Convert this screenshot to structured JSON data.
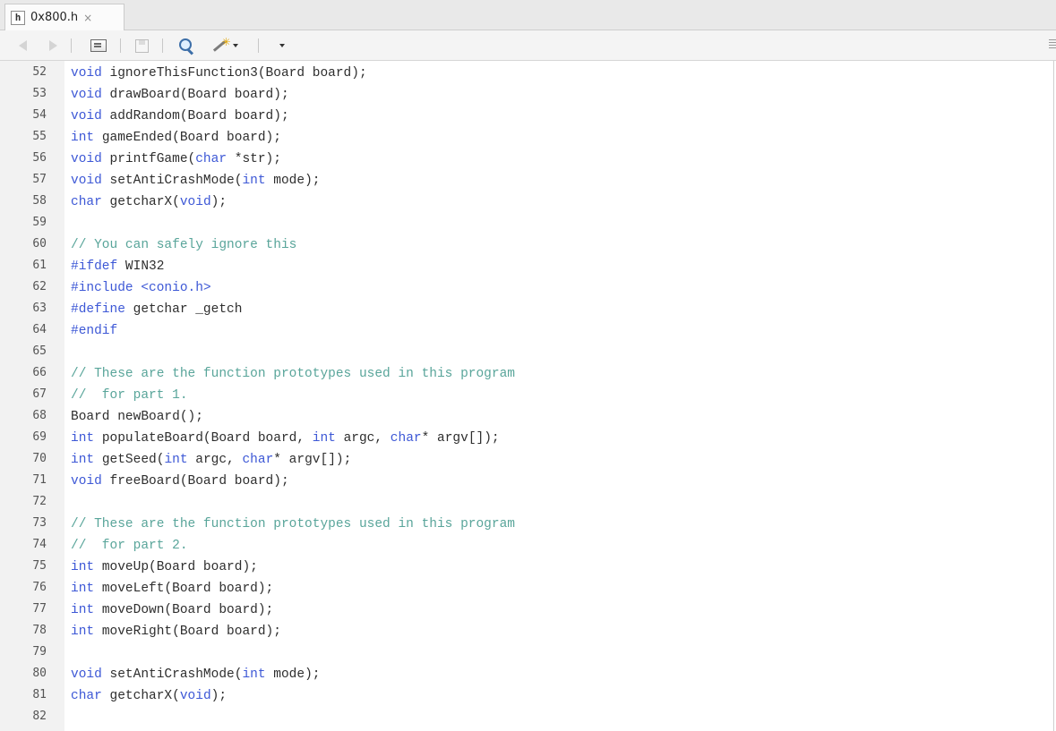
{
  "tab": {
    "icon_letter": "h",
    "title": "0x800.h",
    "close": "×"
  },
  "toolbar": {
    "icons": [
      "back-icon",
      "forward-icon",
      "source-icon",
      "save-icon",
      "search-icon",
      "wand-icon",
      "dropdown-icon",
      "menu-icon"
    ]
  },
  "colors": {
    "keyword": "#3d58d6",
    "comment": "#59a59a",
    "text": "#2e2e2e",
    "gutter": "#f2f2f2"
  },
  "code_lines": [
    {
      "n": "52",
      "t": [
        [
          "kw",
          "void"
        ],
        [
          "",
          "ignoreThisFunction3(Board board);"
        ]
      ]
    },
    {
      "n": "53",
      "t": [
        [
          "kw",
          "void"
        ],
        [
          "",
          "drawBoard(Board board);"
        ]
      ]
    },
    {
      "n": "54",
      "t": [
        [
          "kw",
          "void"
        ],
        [
          "",
          "addRandom(Board board);"
        ]
      ]
    },
    {
      "n": "55",
      "t": [
        [
          "kw",
          "int"
        ],
        [
          "",
          "gameEnded(Board board);"
        ]
      ]
    },
    {
      "n": "56",
      "t": [
        [
          "kw",
          "void"
        ],
        [
          "",
          "printfGame("
        ],
        [
          "kw",
          "char"
        ],
        [
          "",
          " *str);"
        ]
      ]
    },
    {
      "n": "57",
      "t": [
        [
          "kw",
          "void"
        ],
        [
          "",
          "setAntiCrashMode("
        ],
        [
          "kw",
          "int"
        ],
        [
          "",
          " mode);"
        ]
      ]
    },
    {
      "n": "58",
      "t": [
        [
          "kw",
          "char"
        ],
        [
          "",
          "getcharX("
        ],
        [
          "kw",
          "void"
        ],
        [
          "",
          ");"
        ]
      ]
    },
    {
      "n": "59",
      "t": []
    },
    {
      "n": "60",
      "t": [
        [
          "cm",
          "// You can safely ignore this"
        ]
      ]
    },
    {
      "n": "61",
      "t": [
        [
          "pp",
          "#ifdef"
        ],
        [
          "",
          " WIN32"
        ]
      ]
    },
    {
      "n": "62",
      "t": [
        [
          "pp",
          "#include <conio.h>"
        ]
      ]
    },
    {
      "n": "63",
      "t": [
        [
          "pp",
          "#define"
        ],
        [
          "",
          " getchar _getch"
        ]
      ]
    },
    {
      "n": "64",
      "t": [
        [
          "pp",
          "#endif"
        ]
      ]
    },
    {
      "n": "65",
      "t": []
    },
    {
      "n": "66",
      "t": [
        [
          "cm",
          "// These are the function prototypes used in this program"
        ]
      ]
    },
    {
      "n": "67",
      "t": [
        [
          "cm",
          "//  for part 1."
        ]
      ]
    },
    {
      "n": "68",
      "t": [
        [
          "",
          "Board newBoard();"
        ]
      ]
    },
    {
      "n": "69",
      "t": [
        [
          "kw",
          "int"
        ],
        [
          "",
          "populateBoard(Board board, "
        ],
        [
          "kw",
          "int"
        ],
        [
          "",
          " argc, "
        ],
        [
          "kw",
          "char"
        ],
        [
          "",
          "* argv[]);"
        ]
      ]
    },
    {
      "n": "70",
      "t": [
        [
          "kw",
          "int"
        ],
        [
          "",
          "getSeed("
        ],
        [
          "kw",
          "int"
        ],
        [
          "",
          " argc, "
        ],
        [
          "kw",
          "char"
        ],
        [
          "",
          "* argv[]);"
        ]
      ]
    },
    {
      "n": "71",
      "t": [
        [
          "kw",
          "void"
        ],
        [
          "",
          "freeBoard(Board board);"
        ]
      ]
    },
    {
      "n": "72",
      "t": []
    },
    {
      "n": "73",
      "t": [
        [
          "cm",
          "// These are the function prototypes used in this program"
        ]
      ]
    },
    {
      "n": "74",
      "t": [
        [
          "cm",
          "//  for part 2."
        ]
      ]
    },
    {
      "n": "75",
      "t": [
        [
          "kw",
          "int"
        ],
        [
          "",
          "moveUp(Board board);"
        ]
      ]
    },
    {
      "n": "76",
      "t": [
        [
          "kw",
          "int"
        ],
        [
          "",
          "moveLeft(Board board);"
        ]
      ]
    },
    {
      "n": "77",
      "t": [
        [
          "kw",
          "int"
        ],
        [
          "",
          "moveDown(Board board);"
        ]
      ]
    },
    {
      "n": "78",
      "t": [
        [
          "kw",
          "int"
        ],
        [
          "",
          "moveRight(Board board);"
        ]
      ]
    },
    {
      "n": "79",
      "t": []
    },
    {
      "n": "80",
      "t": [
        [
          "kw",
          "void"
        ],
        [
          "",
          "setAntiCrashMode("
        ],
        [
          "kw",
          "int"
        ],
        [
          "",
          " mode);"
        ]
      ]
    },
    {
      "n": "81",
      "t": [
        [
          "kw",
          "char"
        ],
        [
          "",
          "getcharX("
        ],
        [
          "kw",
          "void"
        ],
        [
          "",
          ");"
        ]
      ]
    },
    {
      "n": "82",
      "t": []
    }
  ]
}
